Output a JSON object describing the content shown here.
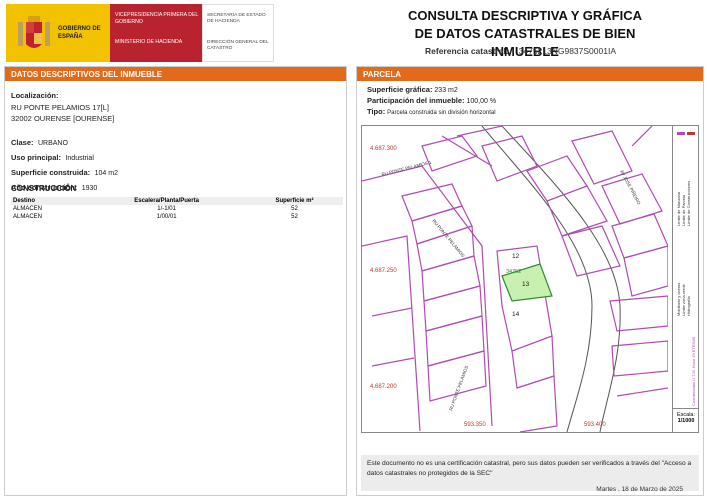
{
  "header": {
    "gov_name": "GOBIERNO DE ESPAÑA",
    "vicepresidencia": "VICEPRESIDENCIA PRIMERA DEL GOBIERNO",
    "ministerio": "MINISTERIO DE HACIENDA",
    "secretaria": "SECRETARÍA DE ESTADO DE HACIENDA",
    "direccion": "DIRECCIÓN GENERAL DEL CATASTRO",
    "title_line1": "CONSULTA DESCRIPTIVA Y GRÁFICA",
    "title_line2": "DE DATOS CATASTRALES DE BIEN INMUEBLE",
    "ref_label": "Referencia catastral:",
    "ref_value": "3475213NG9837S0001IA"
  },
  "left": {
    "heading": "DATOS DESCRIPTIVOS DEL INMUEBLE",
    "localizacion_label": "Localización:",
    "localizacion_line1": "RU PONTE PELAMIOS 17[L]",
    "localizacion_line2": "32002 OURENSE [OURENSE]",
    "clase_label": "Clase:",
    "clase_value": "URBANO",
    "uso_label": "Uso principal:",
    "uso_value": "Industrial",
    "sup_label": "Superficie construida:",
    "sup_value": "104 m2",
    "anio_label": "Año construcción:",
    "anio_value": "1930",
    "construccion_title": "CONSTRUCCIÓN",
    "table": {
      "headers": [
        "Destino",
        "Escalera/Planta/Puerta",
        "Superficie m²"
      ],
      "rows": [
        [
          "ALMACEN",
          "1/-1/01",
          "52"
        ],
        [
          "ALMACEN",
          "1/00/01",
          "52"
        ]
      ]
    }
  },
  "right": {
    "heading": "PARCELA",
    "sup_grafica_label": "Superficie gráfica:",
    "sup_grafica_value": "233 m2",
    "participacion_label": "Participación del inmueble:",
    "participacion_value": "100,00 %",
    "tipo_label": "Tipo:",
    "tipo_value": "Parcela construida sin división horizontal",
    "map": {
      "coord_top": "4.687.300",
      "coord_mid": "4.687.250",
      "coord_bot": "4.687.200",
      "coord_x1": "593.350",
      "coord_x2": "593.400",
      "street1": "RU PONTE PELAMIOS 1",
      "street2": "RU PONTE PELAMIOS",
      "street3": "RU PONTE PELAMIOS",
      "street4": "AV JOSE PIÑEIRO",
      "parcel_12": "12",
      "parcel_13": "13",
      "parcel_14": "14",
      "parcel_ref": "34752",
      "legend": [
        "Límite de Manzana",
        "Límite de Parcela",
        "Límite de Construcciones",
        "Mobiliario y aceras",
        "Límite zona verde",
        "Hidrografía"
      ],
      "legend_side": "Coordenadas U.T.M. Huso 29 ETRS89",
      "escala_label": "Escala:",
      "escala_value": "1/1000",
      "colors": {
        "boundary": "#b04ab4",
        "highlight": "#c8f0b0",
        "highlight_border": "#2e8a2e",
        "road": "#555555"
      }
    },
    "note": "Este documento no es una certificación catastral, pero sus datos pueden ser verificados a través del \"Acceso a datos catastrales no protegidos de la SEC\"",
    "date": "Martes , 18 de Marzo de 2025"
  }
}
